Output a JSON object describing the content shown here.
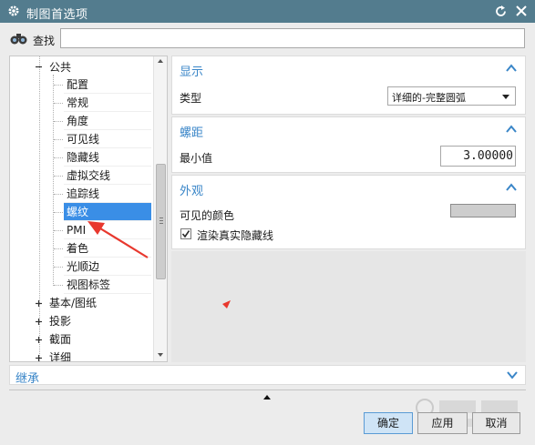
{
  "window": {
    "title": "制图首选项",
    "icons": {
      "settings": "gear-icon",
      "reset": "reset-icon",
      "close": "close-icon"
    }
  },
  "search": {
    "label": "查找",
    "value": "",
    "placeholder": "",
    "icon": "binoculars-icon"
  },
  "tree": {
    "parent": "公共",
    "children": [
      "配置",
      "常规",
      "角度",
      "可见线",
      "隐藏线",
      "虚拟交线",
      "追踪线",
      "螺纹",
      "PMI",
      "着色",
      "光顺边",
      "视图标签"
    ],
    "selected": "螺纹",
    "collapsed": [
      "基本/图纸",
      "投影",
      "截面",
      "详细"
    ]
  },
  "sections": {
    "display": {
      "title": "显示",
      "type_label": "类型",
      "type_value": "详细的-完整圆弧"
    },
    "pitch": {
      "title": "螺距",
      "min_label": "最小值",
      "min_value": "3.00000"
    },
    "appearance": {
      "title": "外观",
      "visible_color_label": "可见的颜色",
      "visible_color": "#cdcdcd",
      "render_hidden_label": "渲染真实隐藏线",
      "render_hidden_checked": true
    }
  },
  "inherit": {
    "label": "继承"
  },
  "buttons": {
    "ok": "确定",
    "apply": "应用",
    "cancel": "取消"
  },
  "colors": {
    "titlebar": "#537c8e",
    "accent": "#3a86c8",
    "selection": "#3a8ee6",
    "annotation": "#e8382e"
  }
}
